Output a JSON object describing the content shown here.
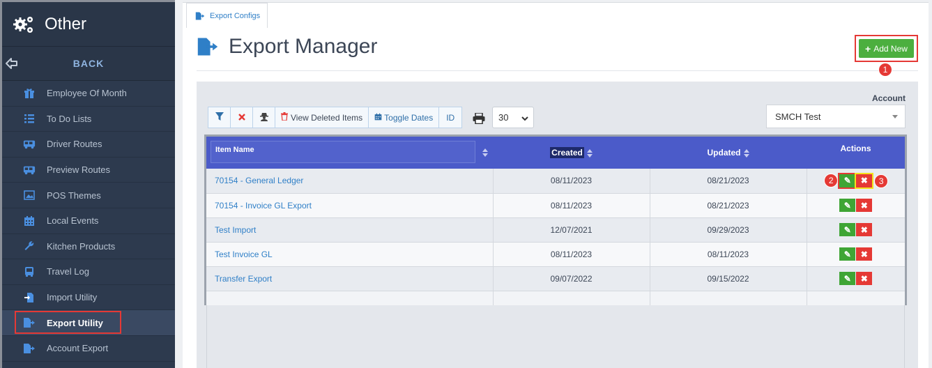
{
  "sidebar": {
    "title": "Other",
    "back_label": "BACK",
    "items": [
      {
        "label": "Employee Of Month",
        "icon": "gift-icon"
      },
      {
        "label": "To Do Lists",
        "icon": "list-icon"
      },
      {
        "label": "Driver Routes",
        "icon": "bus-icon"
      },
      {
        "label": "Preview Routes",
        "icon": "bus-icon"
      },
      {
        "label": "POS Themes",
        "icon": "image-icon"
      },
      {
        "label": "Local Events",
        "icon": "calendar-icon"
      },
      {
        "label": "Kitchen Products",
        "icon": "wrench-icon"
      },
      {
        "label": "Travel Log",
        "icon": "bus-front-icon"
      },
      {
        "label": "Import Utility",
        "icon": "file-import-icon"
      },
      {
        "label": "Export Utility",
        "icon": "file-export-icon"
      },
      {
        "label": "Account Export",
        "icon": "file-export-icon"
      }
    ]
  },
  "tab": {
    "label": "Export Configs"
  },
  "page": {
    "title": "Export Manager"
  },
  "add_button": {
    "label": "Add New"
  },
  "badges": {
    "one": "1",
    "two": "2",
    "three": "3"
  },
  "account": {
    "label": "Account",
    "selected": "SMCH Test"
  },
  "toolbar": {
    "view_deleted": "View Deleted Items",
    "toggle_dates": "Toggle Dates",
    "id": "ID",
    "per_page": "30"
  },
  "table": {
    "headers": {
      "item_name": "Item Name",
      "created": "Created",
      "updated": "Updated",
      "actions": "Actions"
    },
    "rows": [
      {
        "name": "70154 - General Ledger",
        "created": "08/11/2023",
        "updated": "08/21/2023"
      },
      {
        "name": "70154 - Invoice GL Export",
        "created": "08/11/2023",
        "updated": "08/21/2023"
      },
      {
        "name": "Test Import",
        "created": "12/07/2021",
        "updated": "09/29/2023"
      },
      {
        "name": "Test Invoice GL",
        "created": "08/11/2023",
        "updated": "08/11/2023"
      },
      {
        "name": "Transfer Export",
        "created": "09/07/2022",
        "updated": "09/15/2022"
      }
    ]
  },
  "colors": {
    "sidebar_bg": "#2d3a4e",
    "header_blue": "#4b5bc9",
    "success": "#4caf3f",
    "danger": "#e53935",
    "link": "#2f7fc7"
  }
}
